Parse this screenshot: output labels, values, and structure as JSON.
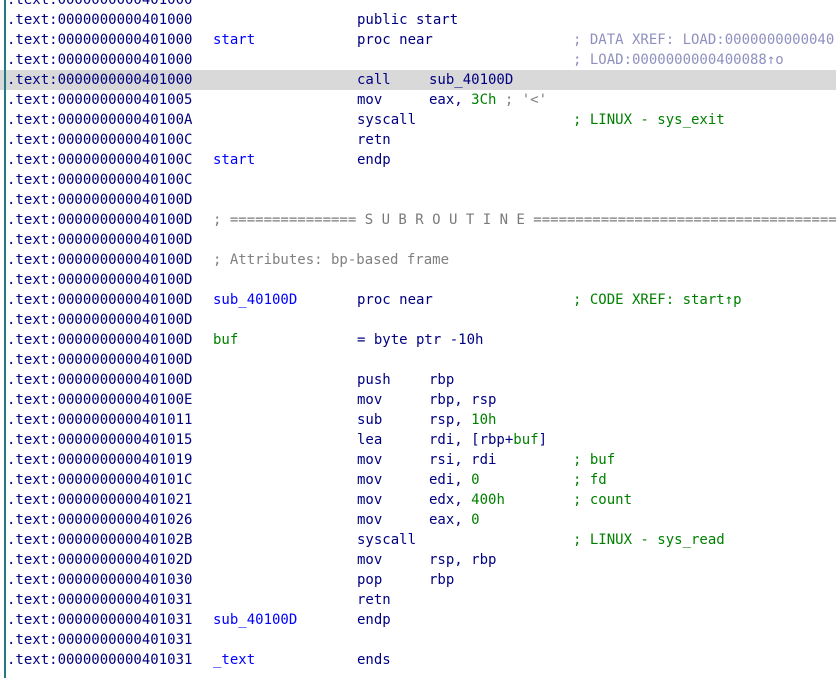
{
  "colors": {
    "address": "#000080",
    "label": "#0000ff",
    "instruction": "#000080",
    "number": "#008000",
    "comment_code": "#008000",
    "comment_xref": "#9090c0",
    "separator": "#7a7a7a",
    "attributes": "#808080",
    "highlight": "#d9d9d9",
    "gutter": "#1f7a86"
  },
  "highlighted_line": 4,
  "lines": [
    {
      "addr": ".text:0000000000401000"
    },
    {
      "addr": ".text:0000000000401000",
      "mnem": "public start"
    },
    {
      "addr": ".text:0000000000401000",
      "name": "start",
      "mnem": "proc near",
      "cmt": "; DATA XREF: LOAD:0000000000040",
      "cmt_kind": "xref"
    },
    {
      "addr": ".text:0000000000401000",
      "cmt": "; LOAD:00000000004000​88↑o",
      "cmt_kind": "xref"
    },
    {
      "addr": ".text:0000000000401000",
      "mnem": "call",
      "ops": "sub_40100D",
      "ops_kind": "label"
    },
    {
      "addr": ".text:0000000000401005",
      "mnem": "mov",
      "ops_pre": "eax, ",
      "ops_num": "3Ch",
      "ops_post": " ; '<'"
    },
    {
      "addr": ".text:000000000040100A",
      "mnem": "syscall",
      "cmt": "; LINUX - sys_exit",
      "cmt_kind": "code"
    },
    {
      "addr": ".text:000000000040100C",
      "mnem": "retn"
    },
    {
      "addr": ".text:000000000040100C",
      "name": "start",
      "mnem": "endp"
    },
    {
      "addr": ".text:000000000040100C"
    },
    {
      "addr": ".text:000000000040100D"
    },
    {
      "addr": ".text:000000000040100D",
      "sep": "; =============== S U B R O U T I N E ======================================="
    },
    {
      "addr": ".text:000000000040100D"
    },
    {
      "addr": ".text:000000000040100D",
      "attr": "; Attributes: bp-based frame"
    },
    {
      "addr": ".text:000000000040100D"
    },
    {
      "addr": ".text:000000000040100D",
      "name": "sub_40100D",
      "mnem": "proc near",
      "cmt": "; CODE XREF: start↑p",
      "cmt_kind": "code"
    },
    {
      "addr": ".text:000000000040100D"
    },
    {
      "addr": ".text:000000000040100D",
      "name": "buf",
      "name_kind": "var",
      "mnem": "= byte ptr -10h"
    },
    {
      "addr": ".text:000000000040100D"
    },
    {
      "addr": ".text:000000000040100D",
      "mnem": "push",
      "ops": "rbp"
    },
    {
      "addr": ".text:000000000040100E",
      "mnem": "mov",
      "ops": "rbp, rsp"
    },
    {
      "addr": ".text:0000000000401011",
      "mnem": "sub",
      "ops_pre": "rsp, ",
      "ops_num": "10h"
    },
    {
      "addr": ".text:0000000000401015",
      "mnem": "lea",
      "ops_pre": "rdi, [rbp+",
      "ops_var": "buf",
      "ops_post": "]"
    },
    {
      "addr": ".text:0000000000401019",
      "mnem": "mov",
      "ops": "rsi, rdi",
      "cmt": "; buf",
      "cmt_kind": "code"
    },
    {
      "addr": ".text:000000000040101C",
      "mnem": "mov",
      "ops_pre": "edi, ",
      "ops_num": "0",
      "cmt": "; fd",
      "cmt_kind": "code"
    },
    {
      "addr": ".text:0000000000401021",
      "mnem": "mov",
      "ops_pre": "edx, ",
      "ops_num": "400h",
      "cmt": "; count",
      "cmt_kind": "code"
    },
    {
      "addr": ".text:0000000000401026",
      "mnem": "mov",
      "ops_pre": "eax, ",
      "ops_num": "0"
    },
    {
      "addr": ".text:000000000040102B",
      "mnem": "syscall",
      "cmt": "; LINUX - sys_read",
      "cmt_kind": "code"
    },
    {
      "addr": ".text:000000000040102D",
      "mnem": "mov",
      "ops": "rsp, rbp"
    },
    {
      "addr": ".text:0000000000401030",
      "mnem": "pop",
      "ops": "rbp"
    },
    {
      "addr": ".text:0000000000401031",
      "mnem": "retn"
    },
    {
      "addr": ".text:0000000000401031",
      "name": "sub_40100D",
      "mnem": "endp"
    },
    {
      "addr": ".text:0000000000401031"
    },
    {
      "addr": ".text:0000000000401031",
      "name": "_text",
      "mnem": "ends"
    }
  ]
}
